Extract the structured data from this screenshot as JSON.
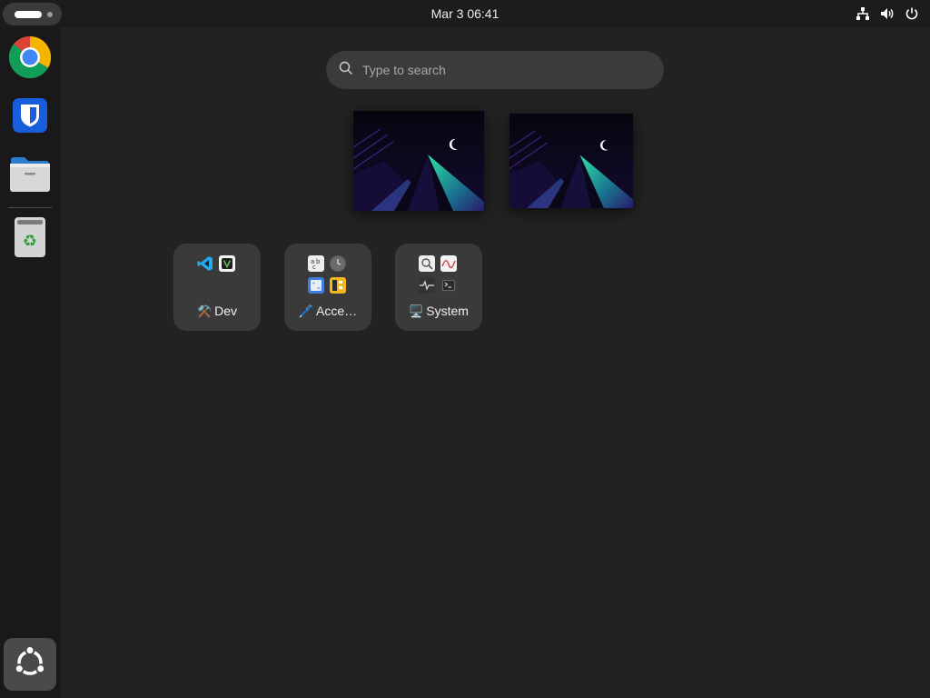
{
  "topbar": {
    "clock": "Mar 3  06:41",
    "tray_icons": [
      "network-icon",
      "volume-icon",
      "power-icon"
    ]
  },
  "dock": {
    "apps": [
      {
        "name": "Google Chrome",
        "icon": "chrome-icon"
      },
      {
        "name": "Bitwarden",
        "icon": "bitwarden-icon"
      },
      {
        "name": "Files",
        "icon": "files-icon"
      },
      {
        "name": "Trash",
        "icon": "trash-icon"
      }
    ],
    "show_apps_icon": "ubuntu-logo-icon"
  },
  "search": {
    "placeholder": "Type to search"
  },
  "workspaces": [
    {
      "index": 1
    },
    {
      "index": 2
    }
  ],
  "folders": [
    {
      "emoji": "⚒️",
      "label": "Dev",
      "apps": [
        "vscode-icon",
        "vim-icon"
      ]
    },
    {
      "emoji": "🖊️",
      "label": "Acce…",
      "apps": [
        "text-editor-icon",
        "clock-icon",
        "calculator-icon",
        "calculator-alt-icon"
      ]
    },
    {
      "emoji": "🖥️",
      "label": "System",
      "apps": [
        "disk-usage-icon",
        "system-monitor-icon",
        "activity-icon",
        "terminal-icon"
      ]
    }
  ]
}
